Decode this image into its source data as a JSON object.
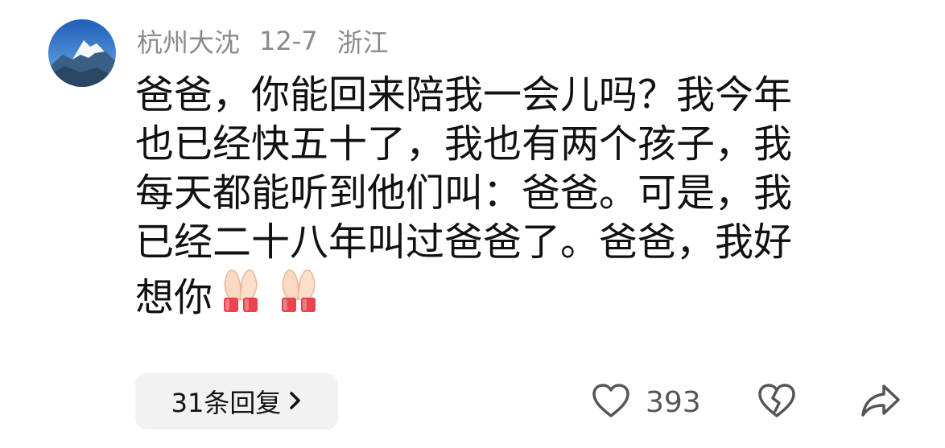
{
  "comment": {
    "author": "杭州大沈",
    "date": "12-7",
    "location": "浙江",
    "lines": [
      "爸爸，你能回来陪我一会儿吗？我今年",
      "也已经快五十了，我也有两个孩子，我",
      "每天都能听到他们叫：爸爸。可是，我",
      "已经二十八年叫过爸爸了。爸爸，我好",
      "想你"
    ],
    "emojis": [
      "folded-hands-icon",
      "folded-hands-icon"
    ]
  },
  "replies": {
    "label": "31条回复"
  },
  "actions": {
    "like_count": "393"
  },
  "colors": {
    "meta_text": "#8a8a8a",
    "body_text": "#111111",
    "reply_bg": "#f2f2f2",
    "icon": "#555555",
    "avatar_sky": "#2f7fd0"
  }
}
